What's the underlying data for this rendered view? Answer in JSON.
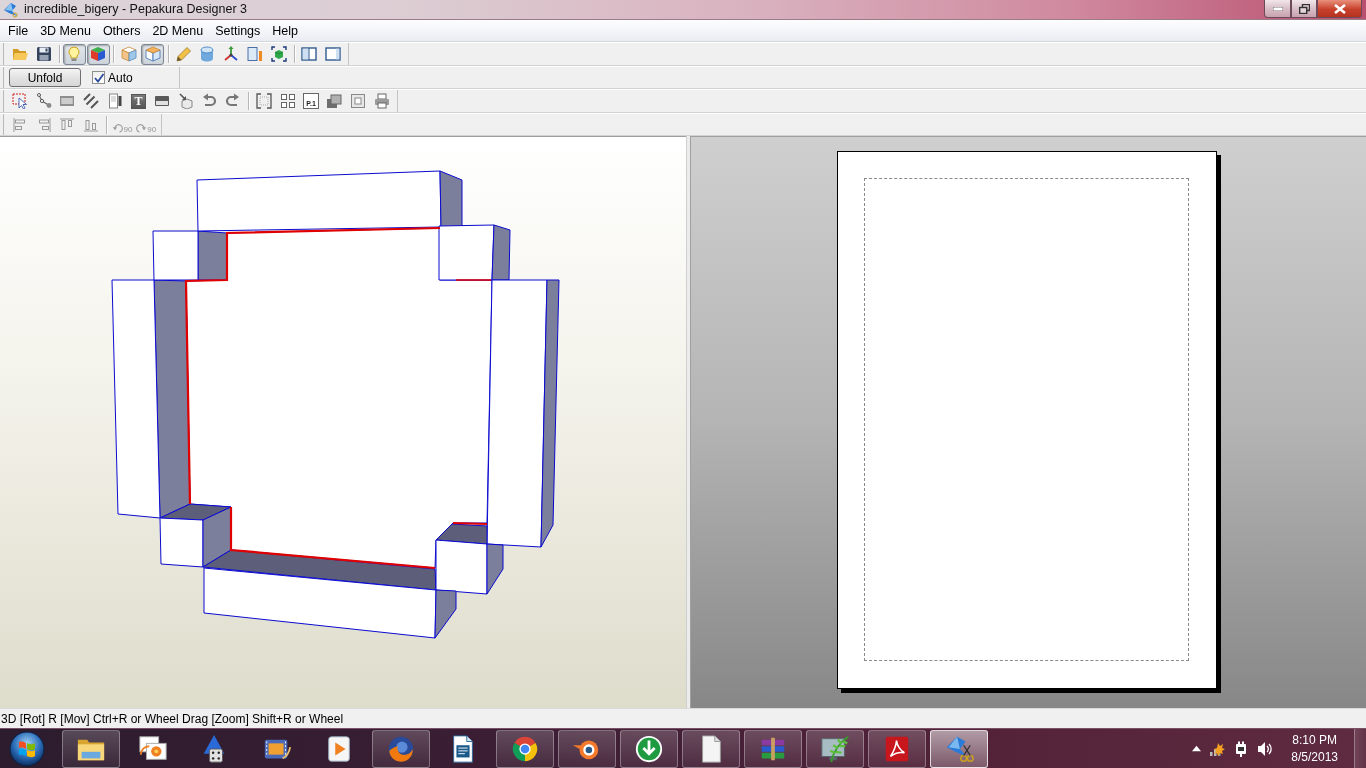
{
  "window": {
    "title": "incredible_bigery - Pepakura Designer 3"
  },
  "menu": [
    "File",
    "3D Menu",
    "Others",
    "2D Menu",
    "Settings",
    "Help"
  ],
  "toolbars": {
    "main": [
      [
        {
          "kind": "folder",
          "pressed": false
        },
        {
          "kind": "save",
          "pressed": false
        }
      ],
      [
        {
          "kind": "bulb",
          "pressed": true
        },
        {
          "kind": "color-cube",
          "pressed": true
        }
      ],
      [
        {
          "kind": "cube",
          "pressed": false
        },
        {
          "kind": "box",
          "pressed": true
        }
      ],
      [
        {
          "kind": "pencil",
          "pressed": false
        },
        {
          "kind": "cylinder",
          "pressed": false
        },
        {
          "kind": "axes",
          "pressed": false
        },
        {
          "kind": "ruler",
          "pressed": false
        },
        {
          "kind": "cube-select",
          "pressed": false
        }
      ],
      [
        {
          "kind": "split-window",
          "pressed": false
        },
        {
          "kind": "window",
          "pressed": false
        }
      ]
    ],
    "unfold": {
      "button": "Unfold",
      "auto": {
        "label": "Auto",
        "checked": true
      }
    },
    "edit": [
      [
        {
          "kind": "select"
        },
        {
          "kind": "node"
        },
        {
          "kind": "strip"
        },
        {
          "kind": "lines"
        },
        {
          "kind": "page-bar"
        },
        {
          "kind": "text-box",
          "label": "T"
        },
        {
          "kind": "panel"
        },
        {
          "kind": "cube-arrow"
        },
        {
          "kind": "undo"
        },
        {
          "kind": "redo"
        }
      ],
      [
        {
          "kind": "corners"
        },
        {
          "kind": "grid"
        },
        {
          "kind": "page-number",
          "label": "P.1"
        },
        {
          "kind": "layers"
        },
        {
          "kind": "frame"
        },
        {
          "kind": "printer"
        }
      ]
    ],
    "align": [
      [
        {
          "kind": "align-left",
          "disabled": true
        },
        {
          "kind": "align-right",
          "disabled": true
        },
        {
          "kind": "align-top",
          "disabled": true
        },
        {
          "kind": "align-bottom",
          "disabled": true
        }
      ],
      [
        {
          "kind": "rotate-left",
          "label": "90",
          "disabled": true
        },
        {
          "kind": "rotate-right",
          "label": "90",
          "disabled": true
        }
      ]
    ]
  },
  "status_bar": "3D [Rot] R [Mov] Ctrl+R or Wheel Drag [Zoom] Shift+R or Wheel",
  "taskbar": {
    "apps": [
      {
        "kind": "folder",
        "open": true,
        "active": false
      },
      {
        "kind": "photos",
        "open": false,
        "active": false
      },
      {
        "kind": "wizard",
        "open": false,
        "active": false
      },
      {
        "kind": "film",
        "open": false,
        "active": false
      },
      {
        "kind": "play",
        "open": false,
        "active": false
      },
      {
        "kind": "globe",
        "open": true,
        "active": false
      },
      {
        "kind": "document",
        "open": false,
        "active": false
      },
      {
        "kind": "segments",
        "open": true,
        "active": false
      },
      {
        "kind": "eye-ring",
        "open": true,
        "active": false
      },
      {
        "kind": "download",
        "open": true,
        "active": false
      },
      {
        "kind": "blank-page",
        "open": true,
        "active": false
      },
      {
        "kind": "books",
        "open": true,
        "active": false
      },
      {
        "kind": "fern",
        "open": true,
        "active": false
      },
      {
        "kind": "swoosh",
        "open": true,
        "active": false
      },
      {
        "kind": "paper-scissors",
        "open": true,
        "active": true
      }
    ],
    "clock": {
      "time": "8:10 PM",
      "date": "8/5/2013"
    }
  }
}
